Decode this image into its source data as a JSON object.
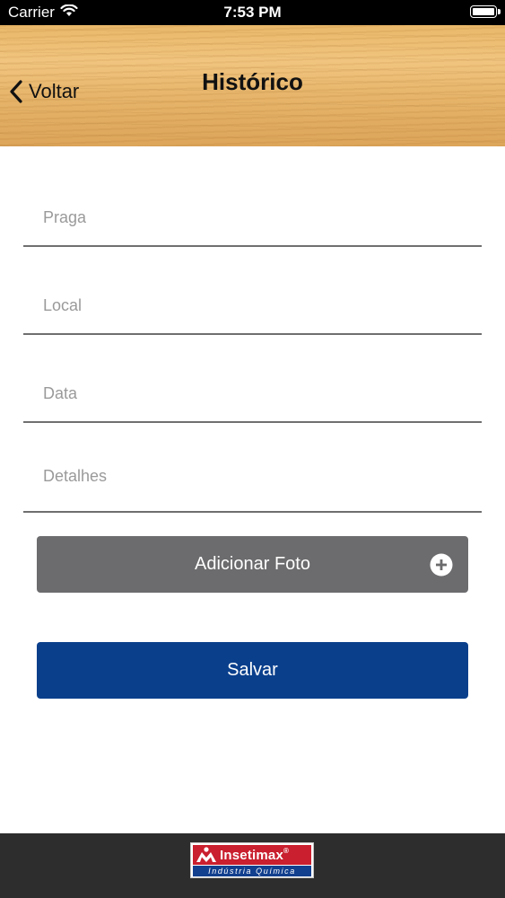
{
  "status_bar": {
    "carrier": "Carrier",
    "time": "7:53 PM",
    "battery_level": 1.0,
    "wifi_icon": "wifi-icon",
    "battery_icon": "battery-icon"
  },
  "nav": {
    "back_label": "Voltar",
    "back_icon": "chevron-left-icon",
    "title": "Histórico"
  },
  "form": {
    "fields": [
      {
        "name": "praga",
        "value": "",
        "placeholder": "Praga"
      },
      {
        "name": "local",
        "value": "",
        "placeholder": "Local"
      },
      {
        "name": "data",
        "value": "",
        "placeholder": "Data"
      },
      {
        "name": "detalhes",
        "value": "",
        "placeholder": "Detalhes"
      }
    ],
    "add_photo_label": "Adicionar Foto",
    "add_photo_icon": "plus-circle-icon",
    "save_label": "Salvar"
  },
  "footer": {
    "logo": {
      "brand": "Insetimax",
      "brand_suffix": "®",
      "tagline": "Indústria Química"
    }
  },
  "colors": {
    "save_button": "#0a3f8c",
    "photo_button": "#6c6b6d",
    "footer_bg": "#2d2d2d",
    "logo_red": "#c91f2e",
    "logo_blue": "#123f8e"
  }
}
